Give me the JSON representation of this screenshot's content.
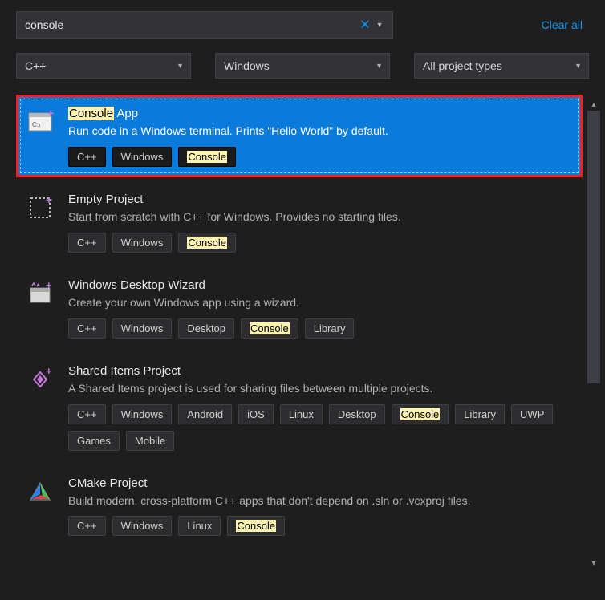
{
  "colors": {
    "highlight_bg": "#fff3b0",
    "accent_blue": "#0e97f0",
    "selected_bg": "#0a7bdb",
    "selected_outline": "#ff1c1c"
  },
  "search": {
    "value": "console",
    "highlight_term": "Console"
  },
  "clear_all": "Clear all",
  "filters": {
    "language": "C++",
    "platform": "Windows",
    "project_type": "All project types"
  },
  "templates": [
    {
      "icon": "console",
      "title_parts": [
        "Console",
        " App"
      ],
      "desc": "Run code in a Windows terminal. Prints \"Hello World\" by default.",
      "tags": [
        "C++",
        "Windows",
        "Console"
      ],
      "selected": true
    },
    {
      "icon": "empty",
      "title_parts": [
        "Empty Project"
      ],
      "desc": "Start from scratch with C++ for Windows. Provides no starting files.",
      "tags": [
        "C++",
        "Windows",
        "Console"
      ],
      "selected": false
    },
    {
      "icon": "wizard",
      "title_parts": [
        "Windows Desktop Wizard"
      ],
      "desc": "Create your own Windows app using a wizard.",
      "tags": [
        "C++",
        "Windows",
        "Desktop",
        "Console",
        "Library"
      ],
      "selected": false
    },
    {
      "icon": "shared",
      "title_parts": [
        "Shared Items Project"
      ],
      "desc": "A Shared Items project is used for sharing files between multiple projects.",
      "tags": [
        "C++",
        "Windows",
        "Android",
        "iOS",
        "Linux",
        "Desktop",
        "Console",
        "Library",
        "UWP",
        "Games",
        "Mobile"
      ],
      "selected": false
    },
    {
      "icon": "cmake",
      "title_parts": [
        "CMake Project"
      ],
      "desc": "Build modern, cross-platform C++ apps that don't depend on .sln or .vcxproj files.",
      "tags": [
        "C++",
        "Windows",
        "Linux",
        "Console"
      ],
      "selected": false
    }
  ]
}
